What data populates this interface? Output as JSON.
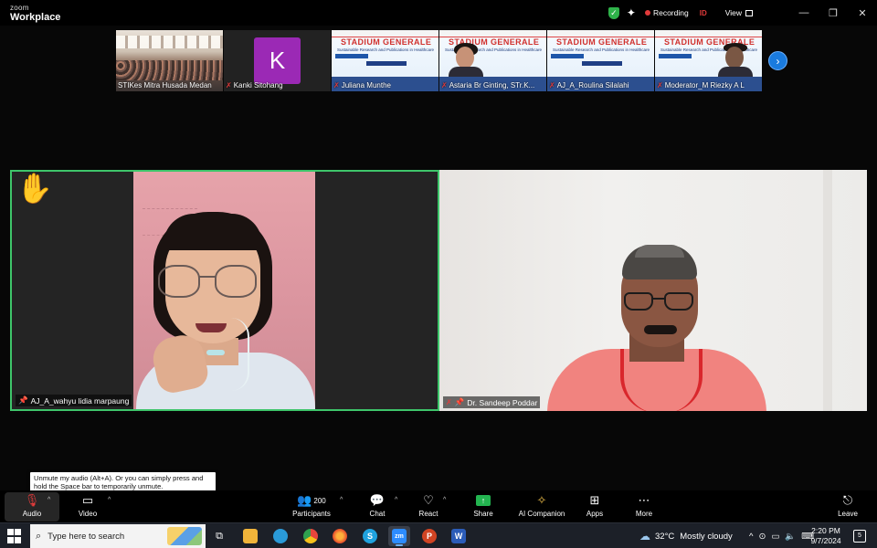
{
  "app": {
    "brand_small": "zoom",
    "brand_large": "Workplace"
  },
  "titlebar": {
    "recording_label": "Recording",
    "id_badge": "ID",
    "view_label": "View",
    "minimize": "—",
    "restore": "❐",
    "close": "✕"
  },
  "thumbnails": [
    {
      "name": "STIKes Mitra Husada Medan",
      "muted": false
    },
    {
      "name": "Kanki Sitohang",
      "muted": true,
      "avatar_letter": "K"
    },
    {
      "name": "Juliana Munthe",
      "muted": true,
      "slide_title": "STADIUM GENERALE",
      "slide_sub": "Sustainable Research and Publications in Healthcare"
    },
    {
      "name": "Astaria Br Ginting, STr.K...",
      "muted": true,
      "slide_title": "STADIUM GENERALE",
      "slide_sub": "Sustainable Research and Publications in Healthcare"
    },
    {
      "name": "AJ_A_Roulina Silalahi",
      "muted": true,
      "slide_title": "STADIUM GENERALE",
      "slide_sub": "Sustainable Research and Publications in Healthcare"
    },
    {
      "name": "Moderator_M Riezky A L",
      "muted": true,
      "slide_title": "STADIUM GENERALE",
      "slide_sub": "Sustainable Research and Publications in Healthcare"
    }
  ],
  "tiles": {
    "left": {
      "name": "AJ_A_wahyu lidia marpaung",
      "hand": "✋"
    },
    "right": {
      "name": "Dr. Sandeep Poddar"
    }
  },
  "tooltip": "Unmute my audio (Alt+A). Or you can simply press and hold the Space bar to temporarily unmute.",
  "toolbar": {
    "audio": "Audio",
    "video": "Video",
    "participants": "Participants",
    "participants_count": "200",
    "chat": "Chat",
    "react": "React",
    "share": "Share",
    "ai_companion": "AI Companion",
    "apps": "Apps",
    "more": "More",
    "leave": "Leave"
  },
  "taskbar": {
    "search_placeholder": "Type here to search",
    "weather_temp": "32°C",
    "weather_desc": "Mostly cloudy",
    "time": "2:20 PM",
    "date": "9/7/2024",
    "notifications": "5"
  }
}
